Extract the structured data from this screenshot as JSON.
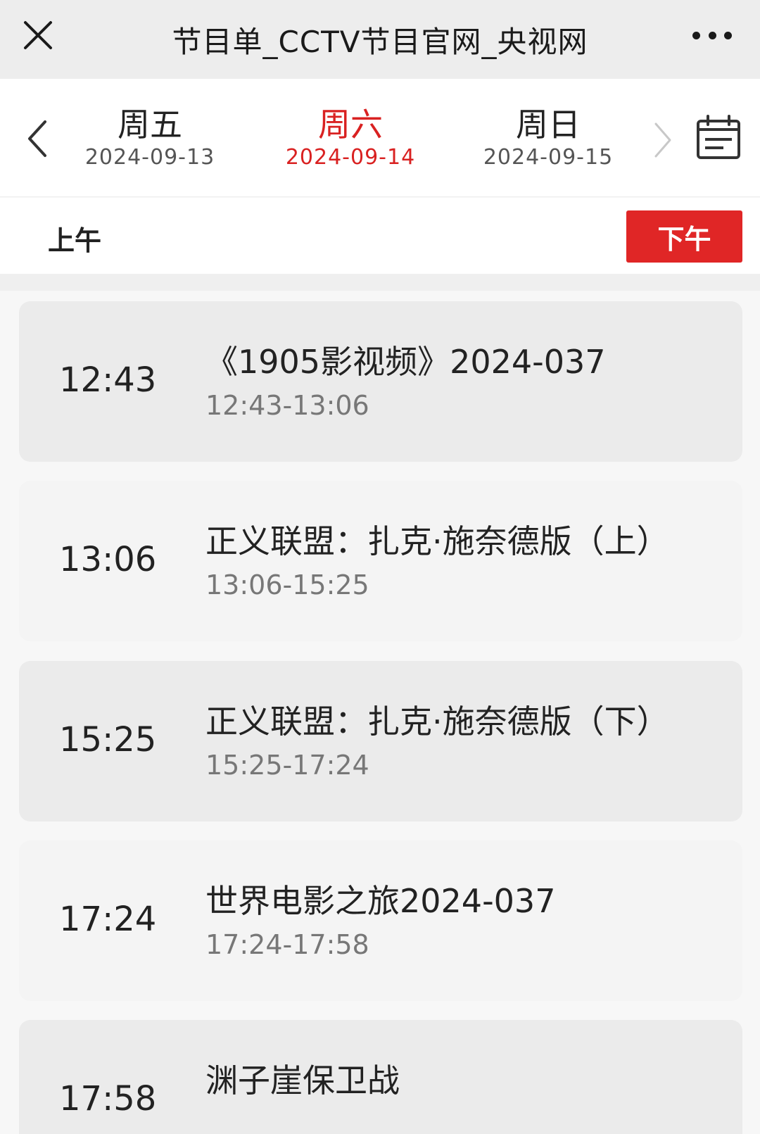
{
  "header": {
    "title": "节目单_CCTV节目官网_央视网"
  },
  "dates": [
    {
      "weekday": "周五",
      "date": "2024-09-13",
      "active": false
    },
    {
      "weekday": "周六",
      "date": "2024-09-14",
      "active": true
    },
    {
      "weekday": "周日",
      "date": "2024-09-15",
      "active": false
    }
  ],
  "period": {
    "am_label": "上午",
    "pm_label": "下午",
    "selected": "pm"
  },
  "programs": [
    {
      "time": "12:43",
      "name": "《1905影视频》2024-037",
      "range": "12:43-13:06"
    },
    {
      "time": "13:06",
      "name": "正义联盟：扎克·施奈德版（上）",
      "range": "13:06-15:25"
    },
    {
      "time": "15:25",
      "name": "正义联盟：扎克·施奈德版（下）",
      "range": "15:25-17:24"
    },
    {
      "time": "17:24",
      "name": "世界电影之旅2024-037",
      "range": "17:24-17:58"
    },
    {
      "time": "17:58",
      "name": "渊子崖保卫战",
      "range": ""
    }
  ],
  "colors": {
    "accent": "#e02626",
    "active_text": "#d92121",
    "card_shade": "#ebebeb",
    "card_light": "#f4f4f4"
  },
  "icons": [
    "close-icon",
    "more-icon",
    "chevron-left-icon",
    "chevron-right-icon",
    "calendar-icon"
  ]
}
